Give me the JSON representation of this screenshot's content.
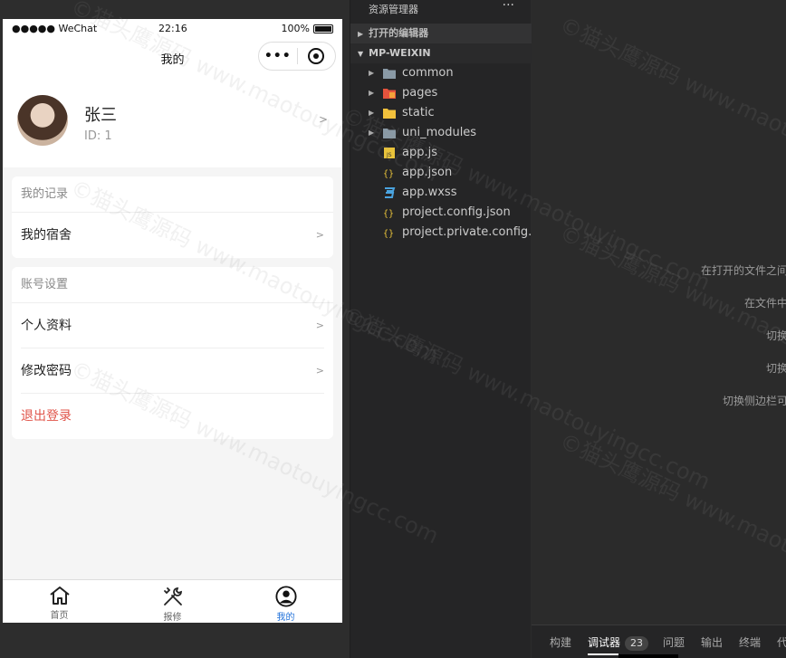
{
  "statusbar": {
    "carrier": "●●●●● WeChat",
    "time": "22:16",
    "battery": "100%"
  },
  "navbar": {
    "title": "我的"
  },
  "profile": {
    "name": "张三",
    "uid": "ID: 1"
  },
  "records_card": {
    "header": "我的记录",
    "items": [
      "我的宿舍"
    ]
  },
  "account_card": {
    "header": "账号设置",
    "items": [
      "个人资料",
      "修改密码"
    ],
    "logout": "退出登录"
  },
  "tabbar": {
    "items": [
      "首页",
      "报修",
      "我的"
    ],
    "active_color": "#1e6fd9"
  },
  "explorer": {
    "title": "资源管理器",
    "more": "···",
    "open_editors": "打开的编辑器",
    "project": "MP-WEIXIN",
    "tree": [
      {
        "name": "common",
        "kind": "folder",
        "icon": "folder-icon"
      },
      {
        "name": "pages",
        "kind": "folder",
        "icon": "pages-folder-icon"
      },
      {
        "name": "static",
        "kind": "folder",
        "icon": "static-folder-icon"
      },
      {
        "name": "uni_modules",
        "kind": "folder",
        "icon": "folder-icon"
      },
      {
        "name": "app.js",
        "kind": "file",
        "icon": "js-file-icon"
      },
      {
        "name": "app.json",
        "kind": "file",
        "icon": "json-file-icon"
      },
      {
        "name": "app.wxss",
        "kind": "file",
        "icon": "css-file-icon"
      },
      {
        "name": "project.config.json",
        "kind": "file",
        "icon": "json-file-icon"
      },
      {
        "name": "project.private.config.js...",
        "kind": "file",
        "icon": "json-file-icon"
      }
    ]
  },
  "editor_hints": [
    "在打开的文件之间",
    "在文件中",
    "切换",
    "切换",
    "切换侧边栏可"
  ],
  "bottom_panel": {
    "tabs": [
      "构建",
      "调试器",
      "问题",
      "输出",
      "终端",
      "代"
    ],
    "badge": "23"
  },
  "watermark": "©猫头鹰源码 www.maotouyingcc.com"
}
